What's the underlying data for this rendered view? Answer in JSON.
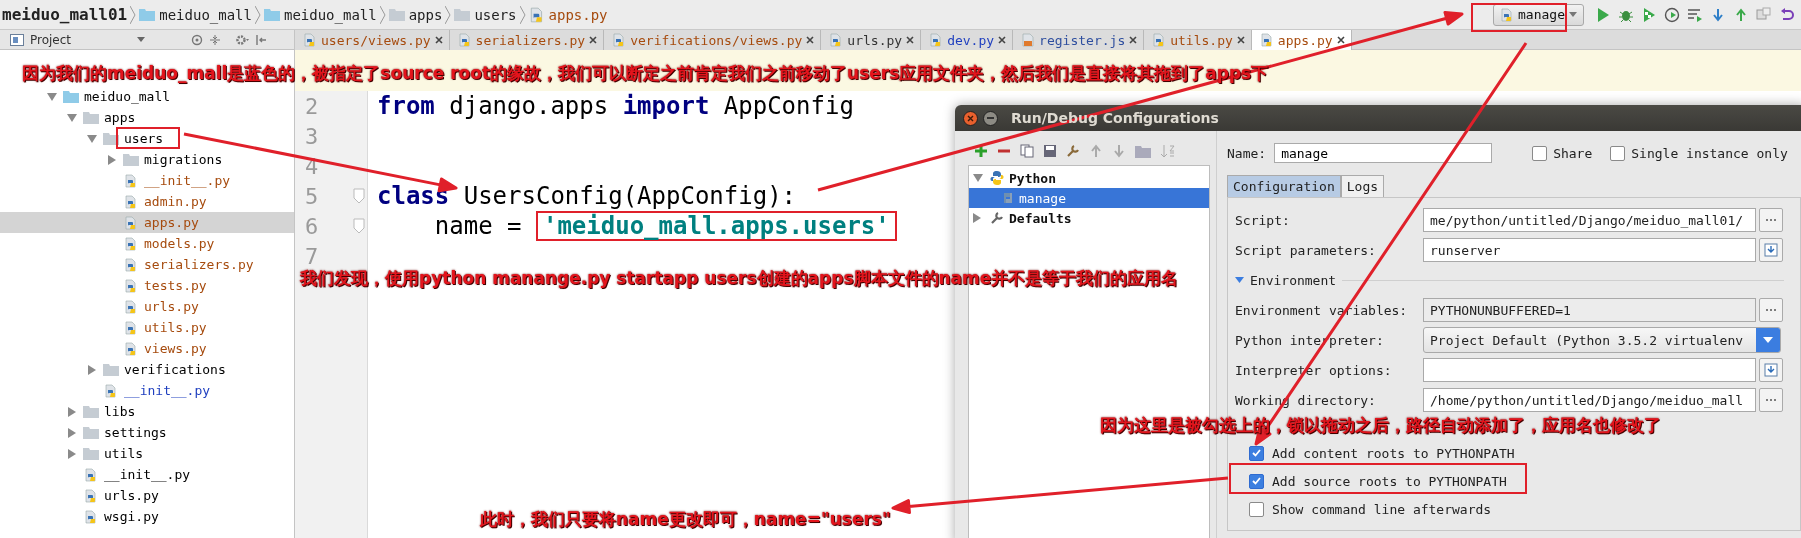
{
  "breadcrumbs": [
    {
      "label": "meiduo_mall01",
      "kind": "project"
    },
    {
      "label": "meiduo_mall",
      "kind": "source"
    },
    {
      "label": "meiduo_mall",
      "kind": "source"
    },
    {
      "label": "apps",
      "kind": "folder"
    },
    {
      "label": "users",
      "kind": "folder"
    },
    {
      "label": "apps.py",
      "kind": "file"
    }
  ],
  "run_config": {
    "label": "manage"
  },
  "project_panel": {
    "title": "Project"
  },
  "tabs": [
    {
      "label": "users/views.py",
      "kind": "py",
      "color": "#a64b0e",
      "selected": false
    },
    {
      "label": "serializers.py",
      "kind": "py",
      "color": "#a64b0e",
      "selected": false
    },
    {
      "label": "verifications/views.py",
      "kind": "py",
      "color": "#a64b0e",
      "selected": false
    },
    {
      "label": "urls.py",
      "kind": "py",
      "color": "#333333",
      "selected": false
    },
    {
      "label": "dev.py",
      "kind": "py",
      "color": "#1f3fbf",
      "selected": false
    },
    {
      "label": "register.js",
      "kind": "js",
      "color": "#2f4f9f",
      "selected": false
    },
    {
      "label": "utils.py",
      "kind": "py",
      "color": "#a64b0e",
      "selected": false
    },
    {
      "label": "apps.py",
      "kind": "py",
      "color": "#a64b0e",
      "selected": true
    }
  ],
  "tree": [
    {
      "label": "meiduo_mall",
      "kind": "source",
      "expanded": true,
      "selected": false,
      "color": "#000000",
      "children": [
        {
          "label": "apps",
          "kind": "folder",
          "expanded": true,
          "selected": false,
          "color": "#000000",
          "children": [
            {
              "label": "users",
              "kind": "folder",
              "expanded": true,
              "selected": false,
              "color": "#000000",
              "children": [
                {
                  "label": "migrations",
                  "kind": "folder",
                  "expanded": false,
                  "selected": false,
                  "color": "#000000"
                },
                {
                  "label": "__init__.py",
                  "kind": "file",
                  "selected": false,
                  "color": "#a64b0e"
                },
                {
                  "label": "admin.py",
                  "kind": "file",
                  "selected": false,
                  "color": "#a64b0e"
                },
                {
                  "label": "apps.py",
                  "kind": "file",
                  "selected": true,
                  "color": "#a64b0e"
                },
                {
                  "label": "models.py",
                  "kind": "file",
                  "selected": false,
                  "color": "#a64b0e"
                },
                {
                  "label": "serializers.py",
                  "kind": "file",
                  "selected": false,
                  "color": "#a64b0e"
                },
                {
                  "label": "tests.py",
                  "kind": "file",
                  "selected": false,
                  "color": "#a64b0e"
                },
                {
                  "label": "urls.py",
                  "kind": "file",
                  "selected": false,
                  "color": "#a64b0e"
                },
                {
                  "label": "utils.py",
                  "kind": "file",
                  "selected": false,
                  "color": "#a64b0e"
                },
                {
                  "label": "views.py",
                  "kind": "file",
                  "selected": false,
                  "color": "#a64b0e"
                }
              ]
            },
            {
              "label": "verifications",
              "kind": "folder",
              "expanded": false,
              "selected": false,
              "color": "#000000"
            },
            {
              "label": "__init__.py",
              "kind": "file",
              "selected": false,
              "color": "#1f3fbf"
            }
          ]
        },
        {
          "label": "libs",
          "kind": "folder",
          "expanded": false,
          "selected": false,
          "color": "#000000"
        },
        {
          "label": "settings",
          "kind": "folder",
          "expanded": false,
          "selected": false,
          "color": "#000000"
        },
        {
          "label": "utils",
          "kind": "folder",
          "expanded": false,
          "selected": false,
          "color": "#000000"
        },
        {
          "label": "__init__.py",
          "kind": "file",
          "selected": false,
          "color": "#000000"
        },
        {
          "label": "urls.py",
          "kind": "file",
          "selected": false,
          "color": "#000000"
        },
        {
          "label": "wsgi.py",
          "kind": "file",
          "selected": false,
          "color": "#000000"
        }
      ]
    }
  ],
  "editor": {
    "lines": [
      {
        "number": "2",
        "fold": false,
        "tokens": [
          {
            "text": "from",
            "kind": "keyword"
          },
          {
            "text": " django.apps ",
            "kind": "plain"
          },
          {
            "text": "import",
            "kind": "keyword"
          },
          {
            "text": " AppConfig",
            "kind": "plain"
          }
        ]
      },
      {
        "number": "3",
        "fold": false
      },
      {
        "number": "4",
        "fold": false
      },
      {
        "number": "5",
        "fold": true,
        "tokens": [
          {
            "text": "class",
            "kind": "keyword"
          },
          {
            "text": " UsersConfig(AppConfig):",
            "kind": "plain"
          }
        ]
      },
      {
        "number": "6",
        "fold": true,
        "tokens": [
          {
            "text": "    name = ",
            "kind": "plain"
          },
          {
            "text": "'meiduo_mall.apps.users'",
            "kind": "string"
          }
        ]
      },
      {
        "number": "7",
        "fold": false
      }
    ]
  },
  "dialog": {
    "title": "Run/Debug Configurations",
    "tree": [
      {
        "label": "Python",
        "kind": "group",
        "expanded": true,
        "selected": false,
        "children": [
          {
            "label": "manage",
            "kind": "config",
            "selected": true
          }
        ]
      },
      {
        "label": "Defaults",
        "kind": "defaults",
        "expanded": false,
        "selected": false
      }
    ],
    "name_field": {
      "label": "Name:",
      "value": "manage"
    },
    "options": [
      {
        "label": "Share",
        "checked": false
      },
      {
        "label": "Single instance only",
        "checked": false
      }
    ],
    "tabs": [
      {
        "label": "Configuration",
        "selected": true
      },
      {
        "label": "Logs",
        "selected": false
      }
    ],
    "fields": [
      {
        "label": "Script:",
        "value": "me/python/untitled/Django/meiduo_mall01/",
        "kind": "browse",
        "disabled": false
      },
      {
        "label": "Script parameters:",
        "value": "runserver",
        "kind": "expand",
        "disabled": false
      }
    ],
    "environment": {
      "label": "Environment",
      "expanded": true,
      "fields": [
        {
          "label": "Environment variables:",
          "value": "PYTHONUNBUFFERED=1",
          "kind": "browse",
          "disabled": true
        },
        {
          "label": "Python interpreter:",
          "value": "Project Default (Python 3.5.2 virtualenv",
          "kind": "dropdown",
          "disabled": false
        },
        {
          "label": "Interpreter options:",
          "kind": "expand",
          "disabled": false
        },
        {
          "label": "Working directory:",
          "value": "/home/python/untitled/Django/meiduo_mall",
          "kind": "browse",
          "disabled": false
        }
      ]
    },
    "checkboxes": [
      {
        "label": "Add content roots to PYTHONPATH",
        "checked": true
      },
      {
        "label": "Add source roots to PYTHONPATH",
        "checked": true
      },
      {
        "label": "Show command line afterwards",
        "checked": false
      }
    ]
  },
  "annotations": [
    {
      "text": "因为我们的meiduo_mall是蓝色的，被指定了source root的缘故，我们可以断定之前肯定我们之前移动了users应用文件夹，然后我们是直接将其拖到了apps下"
    },
    {
      "text": "我们发现，使用python manange.py startapp users创建的apps脚本文件的name并不是等于我们的应用名"
    },
    {
      "text": "因为这里是被勾选上的，锁以拖动之后，路径自动添加了，应用名也修改了"
    },
    {
      "text": "此时，我们只要将name更改即可，name=\"users\""
    }
  ]
}
